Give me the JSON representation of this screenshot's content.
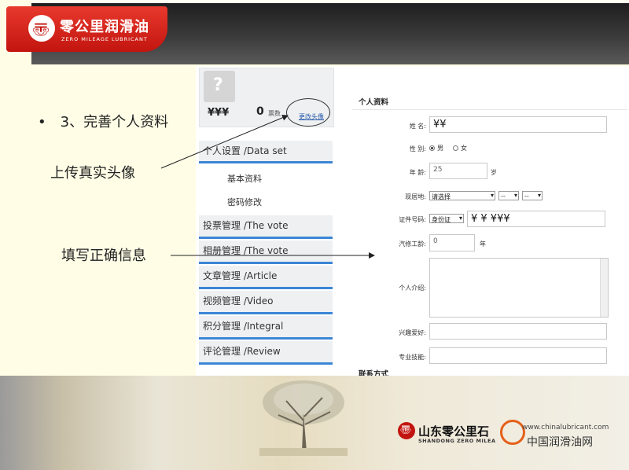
{
  "brand": {
    "name_cn": "零公里润滑油",
    "name_en": "ZERO MILEAGE LUBRICANT"
  },
  "slide": {
    "bullet": "•",
    "step": "3、完善个人资料",
    "callout_avatar": "上传真实头像",
    "callout_info": "填写正确信息"
  },
  "profile": {
    "username": "¥¥¥",
    "votes": "0",
    "votes_label": "票数",
    "change_avatar": "更改头像"
  },
  "menu": {
    "settings": "个人设置 /Data set",
    "sub_basic": "基本资料",
    "sub_password": "密码修改",
    "items": [
      "投票管理 /The vote",
      "相册管理 /The vote",
      "文章管理 /Article",
      "视频管理 /Video",
      "积分管理 /Integral",
      "评论管理 /Review"
    ]
  },
  "form": {
    "section_title": "个人资料",
    "name_label": "姓  名:",
    "name_value": "¥¥",
    "gender_label": "性  别:",
    "gender_male": "男",
    "gender_female": "女",
    "age_label": "年  龄:",
    "age_value": "25",
    "age_unit": "岁",
    "location_label": "现居地:",
    "location_value": "请选择",
    "location_dash": "--",
    "id_label": "证件号码:",
    "id_type": "身份证",
    "id_value": "¥ ¥ ¥¥¥",
    "years_label": "汽修工龄:",
    "years_value": "0",
    "years_unit": "年",
    "intro_label": "个人介绍:",
    "hobby_label": "兴趣爱好:",
    "skill_label": "专业技能:",
    "contact_title": "联系方式"
  },
  "footer": {
    "company_cn": "山东零公里石",
    "company_en": "SHANDONG ZERO MILEA",
    "site_url": "www.chinalubricant.com",
    "site_name": "中国润滑油网"
  }
}
